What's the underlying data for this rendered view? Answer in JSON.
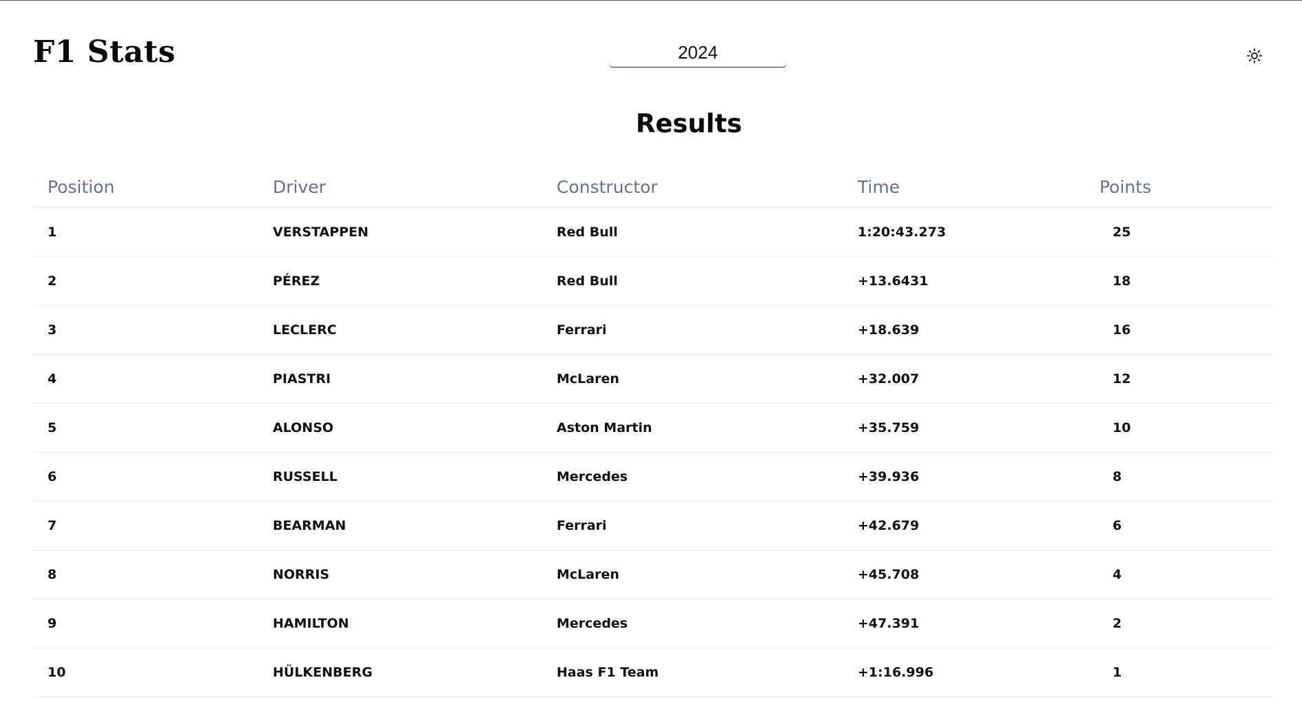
{
  "header": {
    "app_title": "F1 Stats",
    "year_selected": "2024",
    "theme_icon": "sun-icon"
  },
  "main": {
    "section_title": "Results",
    "columns": [
      "Position",
      "Driver",
      "Constructor",
      "Time",
      "Points"
    ],
    "rows": [
      {
        "position": "1",
        "driver": "VERSTAPPEN",
        "constructor": "Red Bull",
        "time": "1:20:43.273",
        "points": "25"
      },
      {
        "position": "2",
        "driver": "PÉREZ",
        "constructor": "Red Bull",
        "time": "+13.6431",
        "points": "18"
      },
      {
        "position": "3",
        "driver": "LECLERC",
        "constructor": "Ferrari",
        "time": "+18.639",
        "points": "16"
      },
      {
        "position": "4",
        "driver": "PIASTRI",
        "constructor": "McLaren",
        "time": "+32.007",
        "points": "12"
      },
      {
        "position": "5",
        "driver": "ALONSO",
        "constructor": "Aston Martin",
        "time": "+35.759",
        "points": "10"
      },
      {
        "position": "6",
        "driver": "RUSSELL",
        "constructor": "Mercedes",
        "time": "+39.936",
        "points": "8"
      },
      {
        "position": "7",
        "driver": "BEARMAN",
        "constructor": "Ferrari",
        "time": "+42.679",
        "points": "6"
      },
      {
        "position": "8",
        "driver": "NORRIS",
        "constructor": "McLaren",
        "time": "+45.708",
        "points": "4"
      },
      {
        "position": "9",
        "driver": "HAMILTON",
        "constructor": "Mercedes",
        "time": "+47.391",
        "points": "2"
      },
      {
        "position": "10",
        "driver": "HÜLKENBERG",
        "constructor": "Haas F1 Team",
        "time": "+1:16.996",
        "points": "1"
      }
    ]
  },
  "colors": {
    "header_text": "#64748b",
    "body_text": "#111111",
    "row_divider": "#e5e7eb"
  }
}
